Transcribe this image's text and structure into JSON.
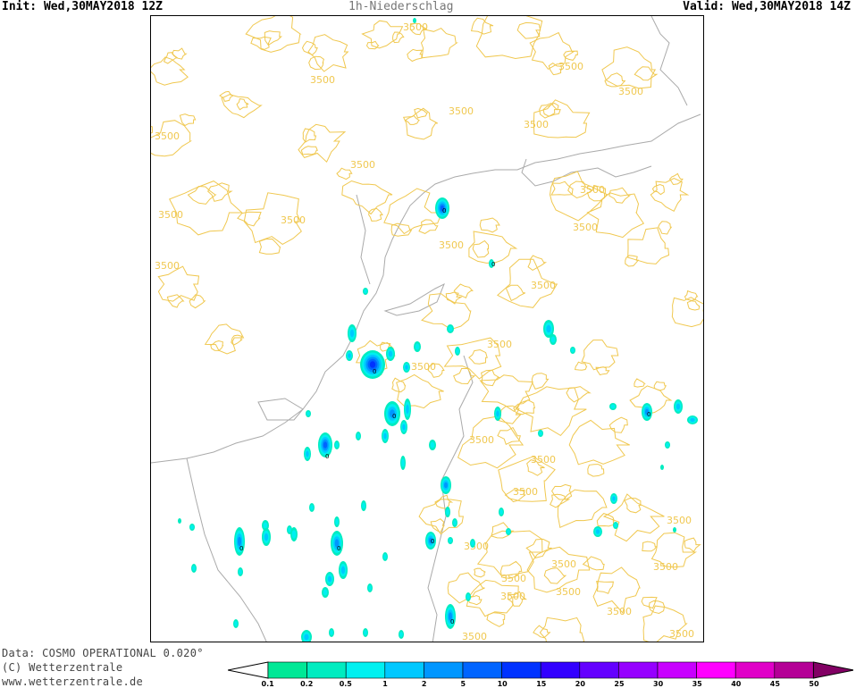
{
  "header": {
    "init": "Init: Wed,30MAY2018 12Z",
    "title": "1h-Niederschlag",
    "valid": "Valid: Wed,30MAY2018 14Z"
  },
  "footer": {
    "data_source": "Data: COSMO OPERATIONAL 0.020°",
    "copyright": "(C) Wetterzentrale",
    "website": "www.wetterzentrale.de"
  },
  "contour_label": "3500",
  "cell_label": "0",
  "colors": {
    "contour": "#f0c850",
    "border": "#aaaaaa",
    "frame": "#000000"
  },
  "colorbar": {
    "labels": [
      "0.1",
      "0.2",
      "0.5",
      "1",
      "2",
      "5",
      "10",
      "15",
      "20",
      "25",
      "30",
      "35",
      "40",
      "45",
      "50"
    ],
    "colors": [
      "#00e896",
      "#00ecc0",
      "#00f0f0",
      "#00c8ff",
      "#0096ff",
      "#0064ff",
      "#0032ff",
      "#3200ff",
      "#6400ff",
      "#9600ff",
      "#c800ff",
      "#ff00ff",
      "#e000c8",
      "#b40096",
      "#820064"
    ]
  }
}
